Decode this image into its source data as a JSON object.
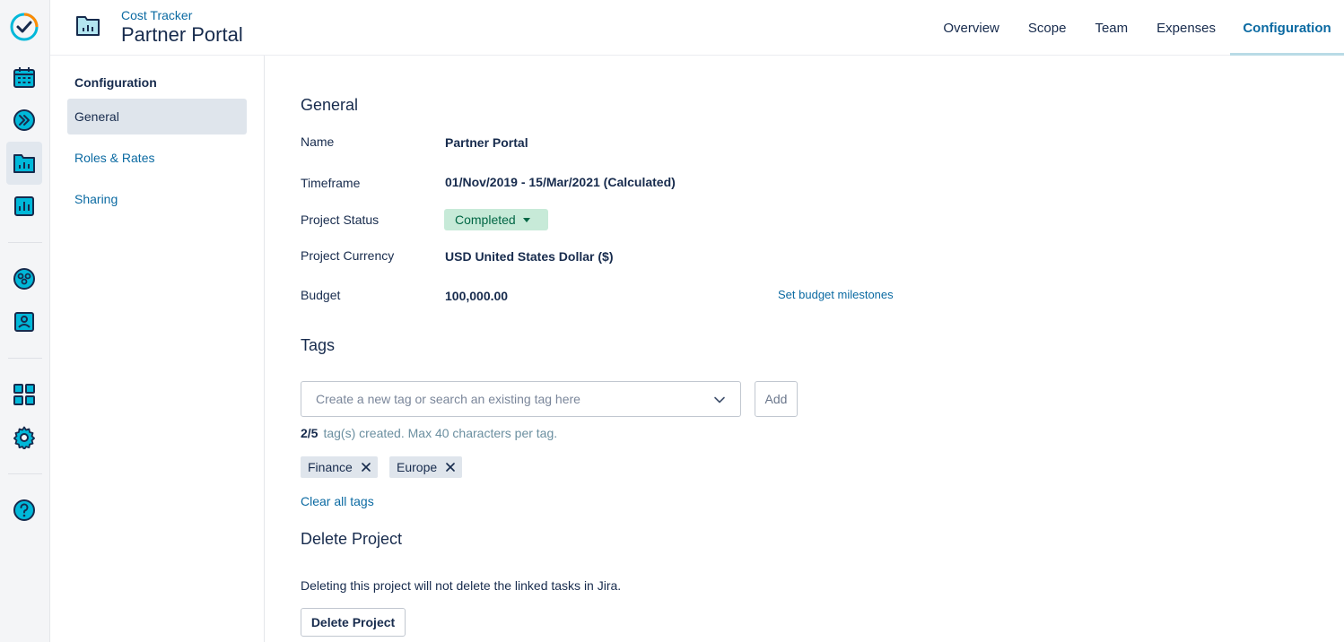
{
  "rail": {
    "icons": [
      "app-logo-icon",
      "calendar-icon",
      "forward-circle-icon",
      "project-folder-icon",
      "reports-icon",
      "teams-icon",
      "user-profile-icon",
      "apps-grid-icon",
      "settings-gear-icon",
      "help-icon"
    ]
  },
  "header": {
    "app_name": "Cost Tracker",
    "project_name": "Partner Portal",
    "tabs": [
      {
        "label": "Overview",
        "active": false
      },
      {
        "label": "Scope",
        "active": false
      },
      {
        "label": "Team",
        "active": false
      },
      {
        "label": "Expenses",
        "active": false
      },
      {
        "label": "Configuration",
        "active": true
      }
    ]
  },
  "subnav": {
    "title": "Configuration",
    "items": [
      {
        "label": "General",
        "active": true
      },
      {
        "label": "Roles & Rates",
        "active": false
      },
      {
        "label": "Sharing",
        "active": false
      }
    ]
  },
  "general": {
    "title": "General",
    "fields": [
      {
        "label": "Name",
        "value": "Partner Portal"
      },
      {
        "label": "Timeframe",
        "value": "01/Nov/2019 - 15/Mar/2021 (Calculated)"
      },
      {
        "label": "Project Status",
        "value": "Completed"
      },
      {
        "label": "Project Currency",
        "value": "USD United States Dollar ($)"
      },
      {
        "label": "Budget",
        "value": "100,000.00"
      }
    ],
    "milestones_link": "Set budget milestones"
  },
  "tags": {
    "title": "Tags",
    "placeholder": "Create a new tag or search an existing tag here",
    "add_label": "Add",
    "count": "2/5",
    "count_text": "tag(s) created. Max 40 characters per tag.",
    "items": [
      "Finance",
      "Europe"
    ],
    "clear_label": "Clear all tags"
  },
  "delete": {
    "title": "Delete Project",
    "note": "Deleting this project will not delete the linked tasks in Jira.",
    "button_label": "Delete Project"
  },
  "colors": {
    "accent": "#0b6aa2",
    "icon_teal": "#00b8d9",
    "status_bg": "#c7ead8",
    "status_text": "#006644"
  }
}
